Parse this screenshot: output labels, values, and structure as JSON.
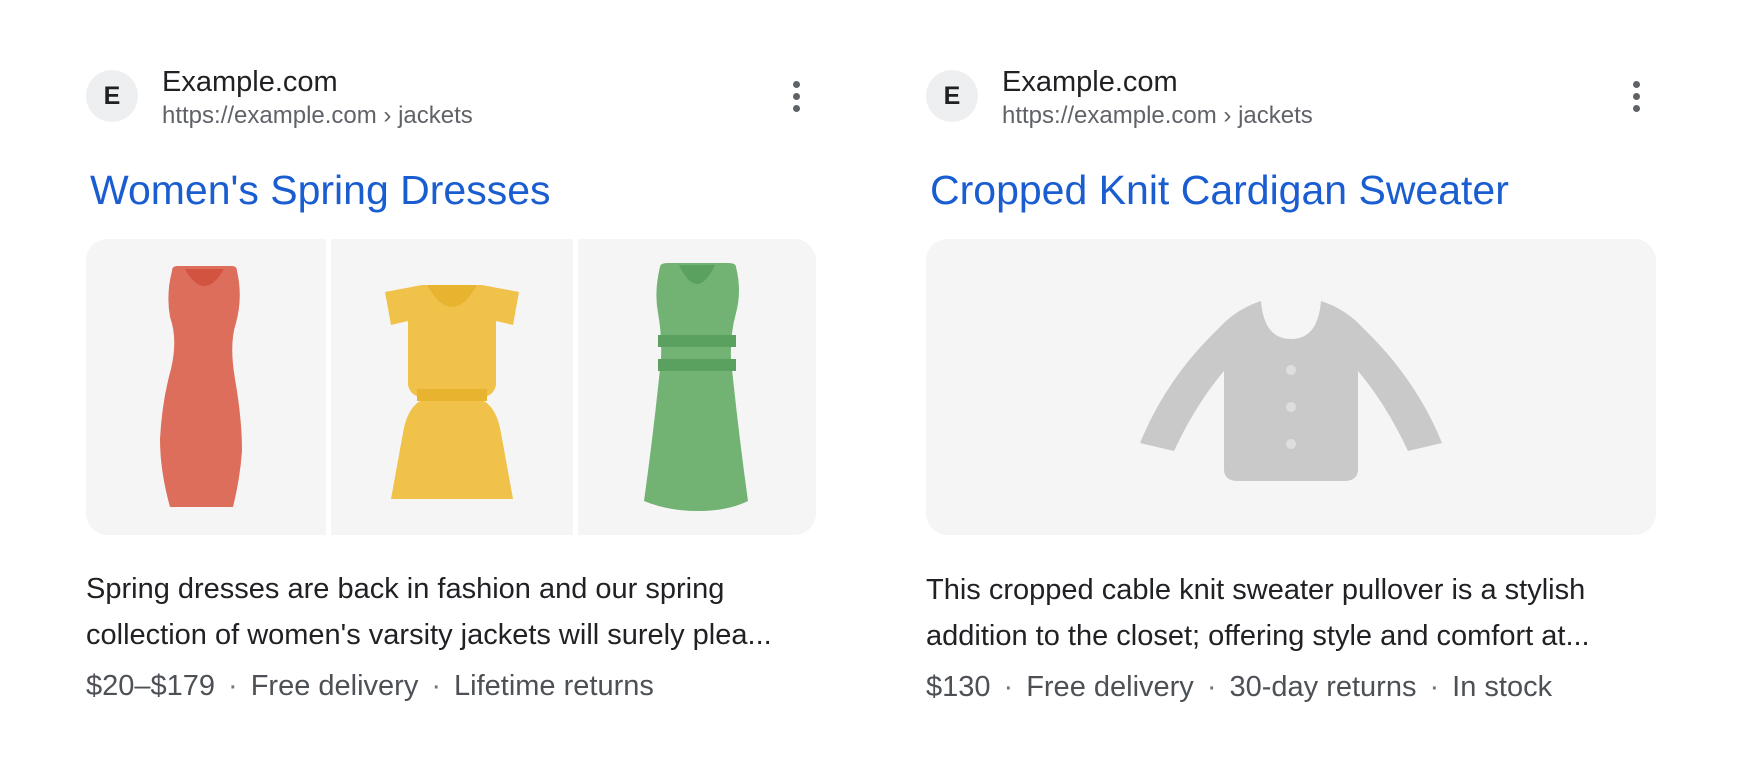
{
  "results": [
    {
      "favicon_letter": "E",
      "site_name": "Example.com",
      "site_url": "https://example.com › jackets",
      "title": "Women's Spring Dresses",
      "images": [
        "red-dress-image",
        "yellow-dress-image",
        "green-dress-image"
      ],
      "snippet_lines": [
        "Spring dresses are back in fashion and our spring",
        "collection of women's varsity jackets will surely plea..."
      ],
      "meta": [
        "$20–$179",
        "Free delivery",
        "Lifetime returns"
      ],
      "colors": {
        "red": "#dd6e5c",
        "yellow": "#f0c24a",
        "green": "#72b374"
      }
    },
    {
      "favicon_letter": "E",
      "site_name": "Example.com",
      "site_url": "https://example.com › jackets",
      "title": "Cropped Knit Cardigan Sweater",
      "images": [
        "cardigan-placeholder-image"
      ],
      "snippet_lines": [
        "This cropped cable knit sweater pullover is a stylish",
        "addition to the closet; offering style and comfort at..."
      ],
      "meta": [
        "$130",
        "Free delivery",
        "30-day returns",
        "In stock"
      ],
      "colors": {
        "placeholder": "#c9c9c9"
      }
    }
  ],
  "colors": {
    "title_link": "#1a5dd0",
    "body_text": "#202124",
    "secondary_text": "#5f6368",
    "panel_bg": "#f5f5f5"
  }
}
